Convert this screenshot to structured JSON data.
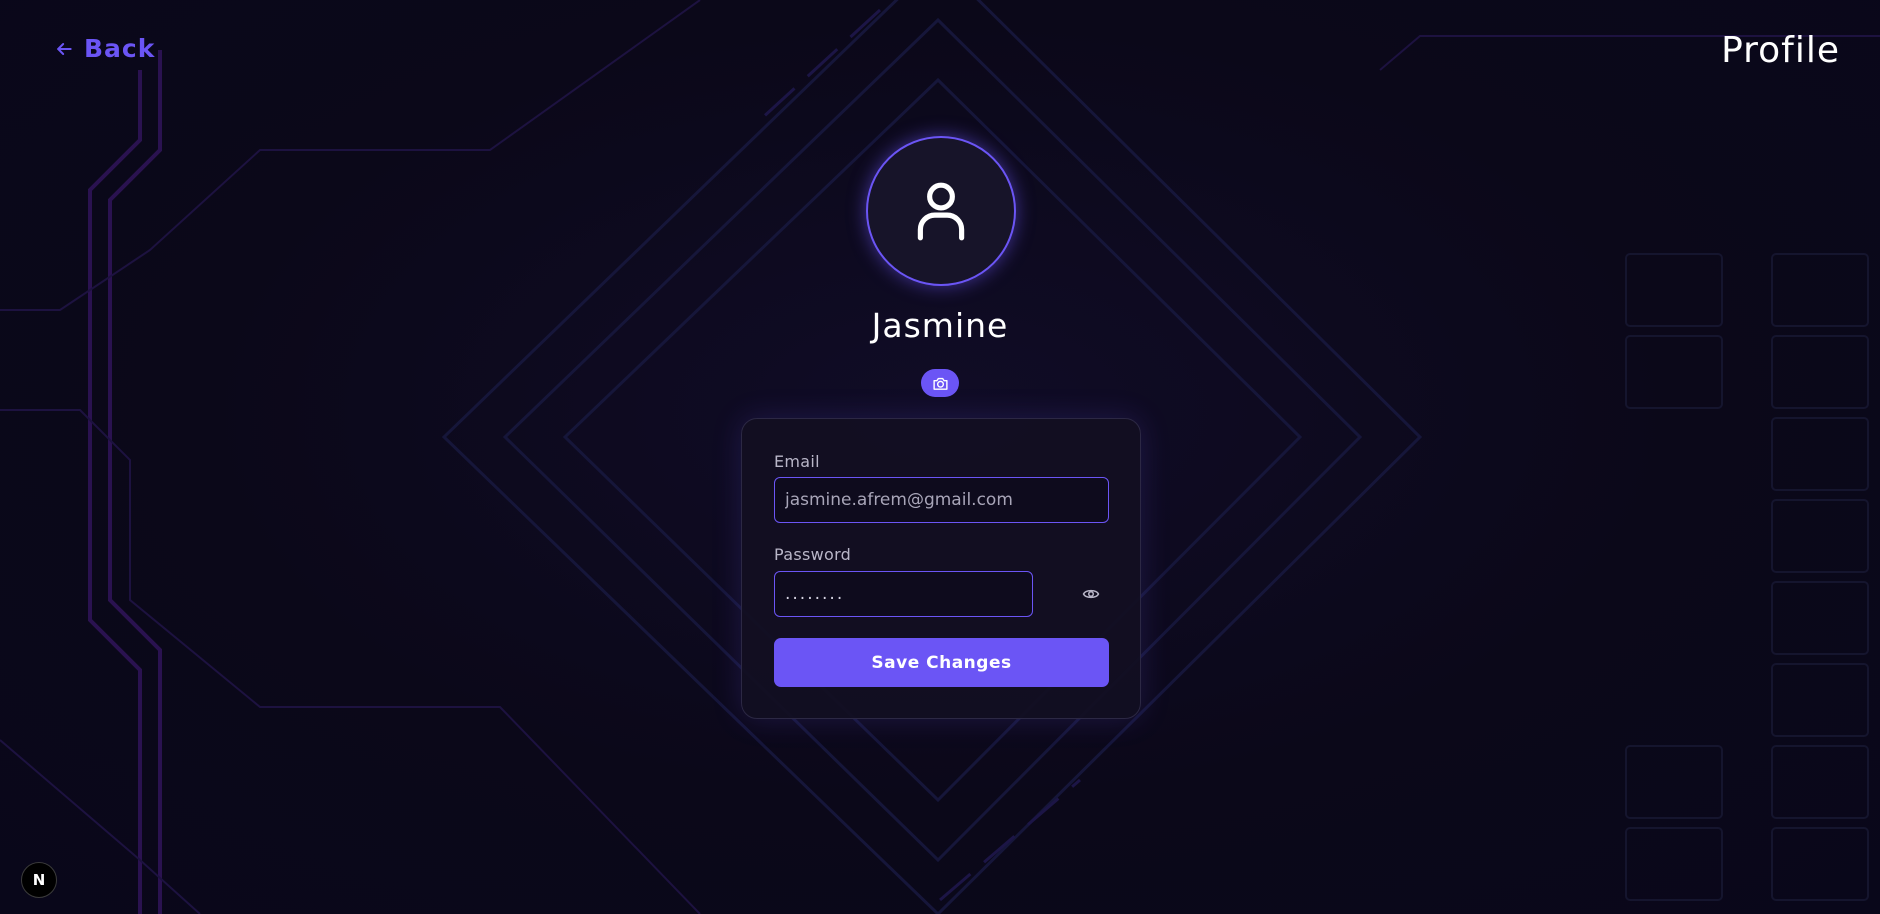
{
  "header": {
    "back_label": "Back",
    "page_title": "Profile"
  },
  "profile": {
    "name": "Jasmine",
    "avatar_icon": "user-icon",
    "change_photo_icon": "camera-icon"
  },
  "form": {
    "email_label": "Email",
    "email_value": "jasmine.afrem@gmail.com",
    "password_label": "Password",
    "password_value": "........",
    "show_password_icon": "eye-icon",
    "save_label": "Save Changes"
  },
  "badge": {
    "label": "N"
  },
  "colors": {
    "accent": "#6b55f5",
    "background": "#0b0819",
    "card": "#120f22"
  }
}
